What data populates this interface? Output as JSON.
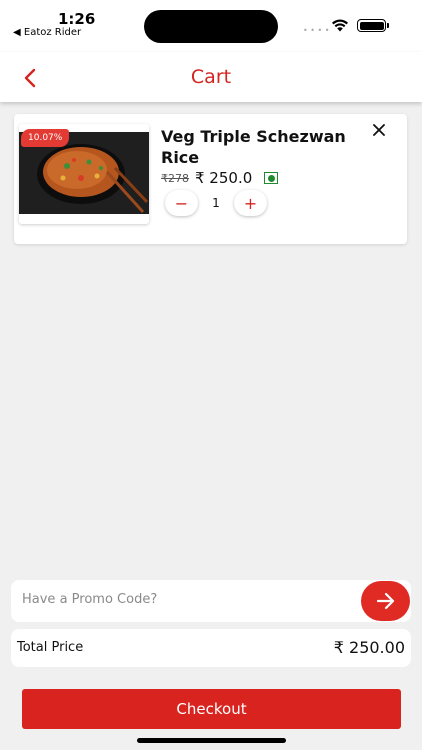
{
  "status_bar": {
    "time": "1:26",
    "back_app": "◀ Eatoz Rider",
    "signal": "• • • •"
  },
  "header": {
    "title": "Cart",
    "back_icon": "chevron-left-icon"
  },
  "cart": {
    "items": [
      {
        "name": "Veg Triple Schezwan Rice",
        "discount": "10.07%",
        "old_price": "₹278",
        "price": "₹ 250.0",
        "quantity": "1",
        "minus_label": "−",
        "plus_label": "+",
        "veg": true
      }
    ]
  },
  "promo": {
    "placeholder": "Have a Promo Code?",
    "value": ""
  },
  "total": {
    "label": "Total Price",
    "value": "₹ 250.00"
  },
  "checkout": {
    "label": "Checkout"
  },
  "colors": {
    "accent": "#d32420",
    "veg_green": "#1f8a2e",
    "background": "#f0f0f0"
  }
}
